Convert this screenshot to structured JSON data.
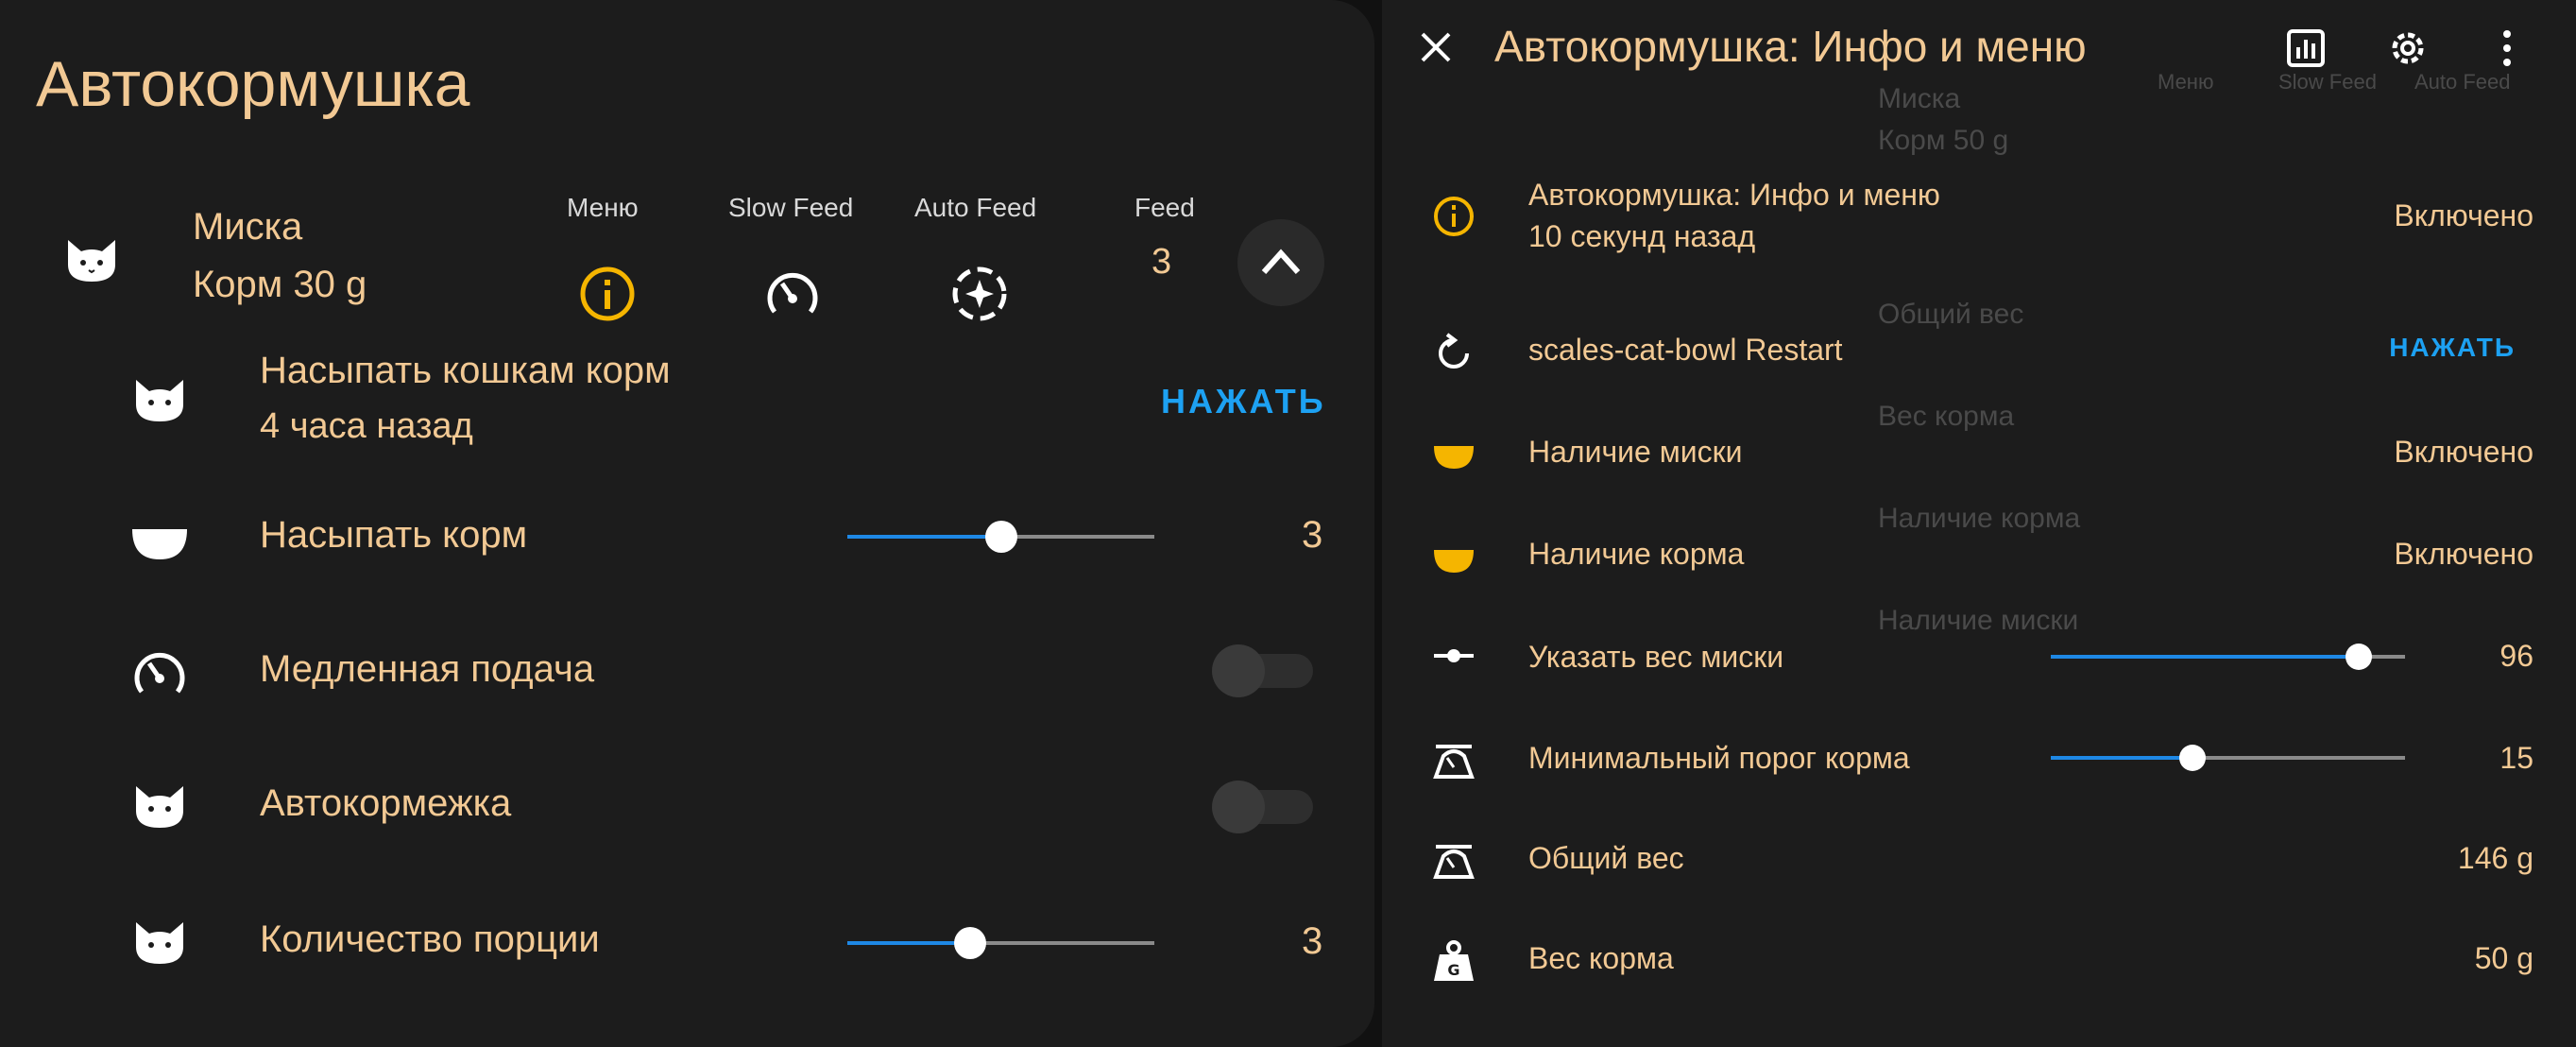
{
  "colors": {
    "accent_text": "#f2c994",
    "yellow": "#f5b500",
    "blue": "#1e88e5",
    "link": "#1da1f2"
  },
  "left": {
    "title": "Автокормушка",
    "device": {
      "name": "Миска",
      "state": "Корм 30 g",
      "icon": "cat-icon"
    },
    "columns": [
      {
        "label": "Меню",
        "icon": "info-icon"
      },
      {
        "label": "Slow Feed",
        "icon": "speedometer-icon"
      },
      {
        "label": "Auto Feed",
        "icon": "auto-feed-icon"
      },
      {
        "label": "Feed",
        "value": "3"
      }
    ],
    "rows": [
      {
        "icon": "cat-icon",
        "name": "Насыпать кошкам корм",
        "secondary": "4 часа назад",
        "action": "НАЖАТЬ"
      },
      {
        "icon": "bowl-icon",
        "name": "Насыпать корм",
        "slider": 0.5,
        "value": "3"
      },
      {
        "icon": "speedometer-icon",
        "name": "Медленная подача",
        "switch_on": false
      },
      {
        "icon": "cat-icon",
        "name": "Автокормежка",
        "switch_on": false
      },
      {
        "icon": "cat-icon",
        "name": "Количество порции",
        "slider": 0.4,
        "value": "3"
      }
    ]
  },
  "right": {
    "title": "Автокормушка: Инфо и меню",
    "toolbar": [
      "close-icon",
      "history-chart-icon",
      "settings-gear-icon",
      "more-vertical-icon"
    ],
    "background_ghost": {
      "columns": [
        "Меню",
        "Slow Feed",
        "Auto Feed"
      ],
      "device_name": "Миска",
      "device_state": "Корм 50 g",
      "items": [
        "Общий вес",
        "Вес корма",
        "Наличие корма",
        "Наличие миски"
      ]
    },
    "rows": [
      {
        "icon": "info-icon",
        "name": "Автокормушка: Инфо и меню",
        "secondary": "10 секунд назад",
        "value": "Включено"
      },
      {
        "icon": "restart-icon",
        "name": "scales-cat-bowl Restart",
        "action": "НАЖАТЬ"
      },
      {
        "icon": "bowl-yellow-icon",
        "name": "Наличие миски",
        "value": "Включено"
      },
      {
        "icon": "bowl-yellow-icon",
        "name": "Наличие корма",
        "value": "Включено"
      },
      {
        "icon": "scale-bar-icon",
        "name": "Указать вес миски",
        "slider": 0.87,
        "value": "96"
      },
      {
        "icon": "scale-icon",
        "name": "Минимальный порог корма",
        "slider": 0.4,
        "value": "15"
      },
      {
        "icon": "scale-icon",
        "name": "Общий вес",
        "value": "146 g"
      },
      {
        "icon": "weight-icon",
        "name": "Вес корма",
        "value": "50 g"
      }
    ]
  }
}
